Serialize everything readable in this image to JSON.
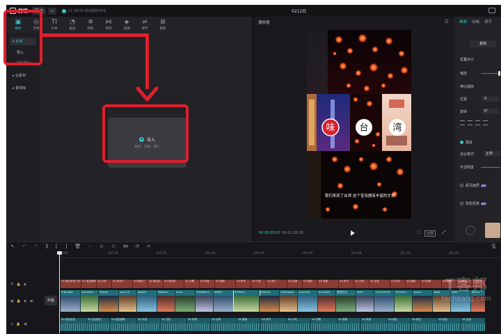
{
  "titlebar": {
    "app_name": "剪辑",
    "menu_label": "菜单",
    "back_label": "<",
    "autosave_text": "11:38:59 自动保存本地",
    "project_title": "0212日"
  },
  "media_tools": [
    {
      "label": "媒体",
      "icon": "▣"
    },
    {
      "label": "音频",
      "icon": "◎"
    },
    {
      "label": "文本",
      "icon": "TI"
    },
    {
      "label": "贴纸",
      "icon": "◔"
    },
    {
      "label": "特效",
      "icon": "✲"
    },
    {
      "label": "转场",
      "icon": "⋈"
    },
    {
      "label": "滤镜",
      "icon": "◈"
    },
    {
      "label": "调节",
      "icon": "⇌"
    },
    {
      "label": "模板",
      "icon": "⊞"
    }
  ],
  "sidebar": {
    "local_label": "▾ 本地",
    "import_label": "导入",
    "preset_label": "我的预设",
    "cloud_label": "▸ 云素材",
    "library_label": "▸ 素材库"
  },
  "drop_zone": {
    "import_label": "导入",
    "hint": "视频、音频、图片"
  },
  "player": {
    "title": "播放器",
    "current_time": "00:00:00:00",
    "total_time": "00:01:26:20",
    "ratio_label": "比例",
    "subtitle": "我们来到了台湾 这个宝岛拥有丰富的文化",
    "glyphs": [
      "味",
      "台",
      "湾"
    ]
  },
  "inspector": {
    "tabs": [
      "画面",
      "动画",
      "调节"
    ],
    "basic_label": "基础",
    "position_size_label": "位置大小",
    "scale_label": "缩放",
    "uniform_label": "等比缩放",
    "position_label": "位置",
    "position_value": "0",
    "rotate_label": "旋转",
    "rotate_value": "0°",
    "blend_label": "混合",
    "blend_mode_label": "混合模式",
    "blend_mode_value": "正常",
    "opacity_label": "不透明度",
    "super_res_label": "超清画质",
    "cutout_label": "智能抠像",
    "vip_badge": "VIP"
  },
  "timeline": {
    "ticks": [
      "00:00",
      "|00:10",
      "|00:20",
      "|00:30",
      "|00:40",
      "|00:50",
      "|01:00",
      "|01:10",
      "|01:20"
    ],
    "cover_label": "封面",
    "title_segments": [
      "AA 我们来到了台湾",
      "AA 宝岛拥有丰富",
      "AA 文化",
      "AA 来自于",
      "AA 融合了",
      "AA 原住民",
      "AA 各自的",
      "AA 元素",
      "AA 特色",
      "AA 美食",
      "AA 夜市",
      "AA 小吃",
      "AA 迷人",
      "AA 山海",
      "AA 景色",
      "AA 风景",
      "AA 历史",
      "AA 古迹",
      "AA 台北",
      "AA 台中",
      "AA 高雄",
      "AA 热情",
      "AA 旅程",
      "AA 难忘",
      "AA 再见"
    ],
    "video_segments": [
      "5381d8e",
      "a431f6c5",
      "92be2",
      "aa1115",
      "a8a09",
      "946b25",
      "01a0",
      "050899c1",
      "bf609",
      "937620",
      "295e12",
      "32b35ad5",
      "a1ccc18",
      "bc23283",
      "金色灯火",
      "5af0",
      "15c71a578",
      "23744c7",
      "4ach1",
      "26a2",
      "0aff1",
      "ab7c1"
    ],
    "audio_segments": [
      "AA 台北自由",
      "AA 自由旅行",
      "AA 宝岛拥有",
      "AA 丰富",
      "AA 文化",
      "AA 来到",
      "AA 台湾",
      "AA 美食",
      "AA 夜市",
      "AA 小吃",
      "AA 热情",
      "AA 旅程",
      "AA 风景",
      "AA 难忘",
      "AA 再见",
      "AA 宝岛",
      "AA 自由"
    ]
  },
  "watermark": {
    "main": "T客邦",
    "url": "techbang.com"
  }
}
